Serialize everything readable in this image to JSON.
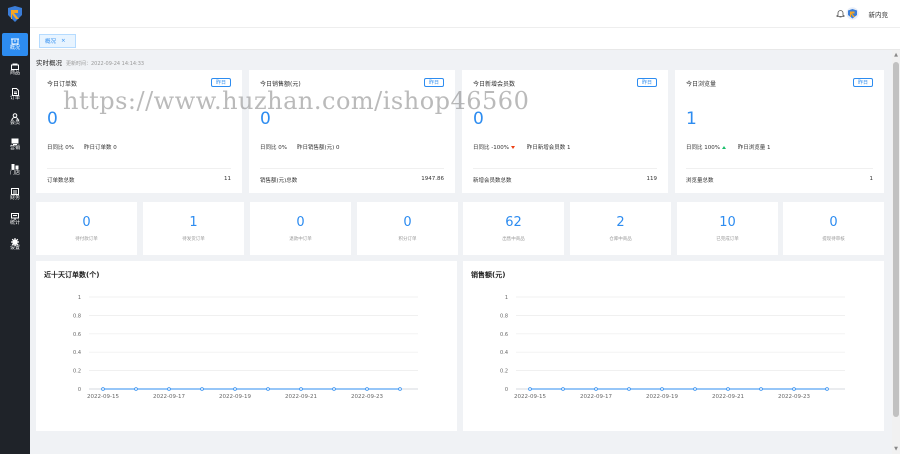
{
  "sidebar": {
    "items": [
      {
        "label": "概况",
        "icon": "overview-icon",
        "active": true
      },
      {
        "label": "商品",
        "icon": "goods-icon"
      },
      {
        "label": "订单",
        "icon": "order-icon"
      },
      {
        "label": "会员",
        "icon": "member-icon"
      },
      {
        "label": "营销",
        "icon": "marketing-icon"
      },
      {
        "label": "门店",
        "icon": "store-icon"
      },
      {
        "label": "财务",
        "icon": "finance-icon"
      },
      {
        "label": "统计",
        "icon": "stats-icon"
      },
      {
        "label": "设置",
        "icon": "settings-icon"
      }
    ]
  },
  "topbar": {
    "user": "新内竞"
  },
  "tabs": [
    {
      "label": "概况",
      "close": "×"
    }
  ],
  "realtime": {
    "title": "实时概况",
    "updated": "更新时间：2022-09-24 14:14:33"
  },
  "cards": [
    {
      "title": "今日订单数",
      "tag": "昨日",
      "value": "0",
      "cmp": "日同比 0%",
      "yest": "昨日订单数 0",
      "trend": "",
      "total_label": "订单数总数",
      "total": "11"
    },
    {
      "title": "今日销售额(元)",
      "tag": "昨日",
      "value": "0",
      "cmp": "日同比 0%",
      "yest": "昨日销售额(元) 0",
      "trend": "",
      "total_label": "销售额(元)总数",
      "total": "1947.86"
    },
    {
      "title": "今日新增会员数",
      "tag": "昨日",
      "value": "0",
      "cmp": "日同比 -100%",
      "yest": "昨日新增会员数 1",
      "trend": "down",
      "total_label": "新增会员数总数",
      "total": "119"
    },
    {
      "title": "今日浏览量",
      "tag": "昨日",
      "value": "1",
      "cmp": "日同比 100%",
      "yest": "昨日浏览量 1",
      "trend": "up",
      "total_label": "浏览量总数",
      "total": "1"
    }
  ],
  "stats": [
    {
      "value": "0",
      "label": "待付款订单"
    },
    {
      "value": "1",
      "label": "待发货订单"
    },
    {
      "value": "0",
      "label": "退款中订单"
    },
    {
      "value": "0",
      "label": "积分订单"
    },
    {
      "value": "62",
      "label": "出售中商品"
    },
    {
      "value": "2",
      "label": "仓库中商品"
    },
    {
      "value": "10",
      "label": "已完成订单"
    },
    {
      "value": "0",
      "label": "提现待审核"
    }
  ],
  "watermark": "https://www.huzhan.com/ishop46560",
  "colors": {
    "accent": "#2d8cf0",
    "sidebar": "#1f2329",
    "down": "#ed4014",
    "up": "#19be6b"
  },
  "chart_data": [
    {
      "type": "line",
      "title": "近十天订单数(个)",
      "x": [
        "2022-09-15",
        "2022-09-16",
        "2022-09-17",
        "2022-09-18",
        "2022-09-19",
        "2022-09-20",
        "2022-09-21",
        "2022-09-22",
        "2022-09-23",
        "2022-09-24"
      ],
      "x_tick_labels": [
        "2022-09-15",
        "2022-09-17",
        "2022-09-19",
        "2022-09-21",
        "2022-09-23"
      ],
      "series": [
        {
          "values": [
            0,
            0,
            0,
            0,
            0,
            0,
            0,
            0,
            0,
            0
          ]
        }
      ],
      "ylim": [
        0,
        1
      ],
      "y_ticks": [
        "0",
        "0.2",
        "0.4",
        "0.6",
        "0.8",
        "1"
      ],
      "grid": true
    },
    {
      "type": "line",
      "title": "销售额(元)",
      "x": [
        "2022-09-15",
        "2022-09-16",
        "2022-09-17",
        "2022-09-18",
        "2022-09-19",
        "2022-09-20",
        "2022-09-21",
        "2022-09-22",
        "2022-09-23",
        "2022-09-24"
      ],
      "x_tick_labels": [
        "2022-09-15",
        "2022-09-17",
        "2022-09-19",
        "2022-09-21",
        "2022-09-23"
      ],
      "series": [
        {
          "values": [
            0,
            0,
            0,
            0,
            0,
            0,
            0,
            0,
            0,
            0
          ]
        }
      ],
      "ylim": [
        0,
        1
      ],
      "y_ticks": [
        "0",
        "0.2",
        "0.4",
        "0.6",
        "0.8",
        "1"
      ],
      "grid": true
    }
  ]
}
